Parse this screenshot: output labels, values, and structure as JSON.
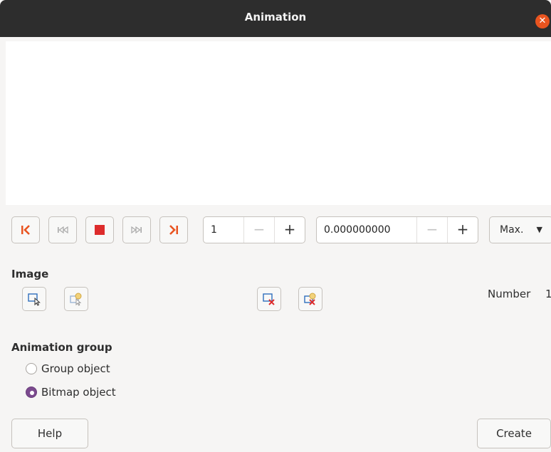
{
  "window": {
    "title": "Animation",
    "close_icon": "close-icon"
  },
  "transport": {
    "first_icon": "first-image-icon",
    "prev_icon": "previous-image-icon",
    "stop_icon": "stop-icon",
    "next_icon": "next-image-icon",
    "last_icon": "last-image-icon",
    "accent_color": "#e95420"
  },
  "image_number": {
    "value": "1",
    "minus": "−",
    "plus": "+"
  },
  "duration": {
    "value": "0.000000000",
    "minus": "−",
    "plus": "+"
  },
  "loop_select": {
    "value": "Max.",
    "arrow": "▼"
  },
  "image_section": {
    "heading": "Image",
    "apply_object_icon": "apply-object-icon",
    "apply_objects_individually_icon": "apply-objects-individually-icon",
    "delete_current_icon": "delete-current-image-icon",
    "delete_all_icon": "delete-all-images-icon",
    "number_label": "Number",
    "number_value": "1"
  },
  "animation_group": {
    "heading": "Animation group",
    "options": [
      {
        "label": "Group object",
        "checked": false
      },
      {
        "label": "Bitmap object",
        "checked": true
      }
    ],
    "radio_color": "#7b4a8e"
  },
  "footer": {
    "help_label": "Help",
    "create_label": "Create"
  }
}
